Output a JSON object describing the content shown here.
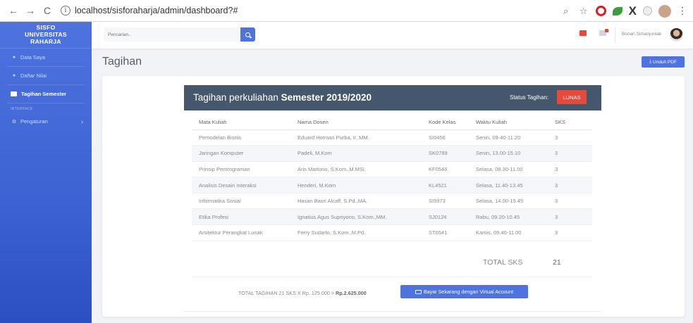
{
  "browser": {
    "url": "localhost/sisforaharja/admin/dashboard?#",
    "back_icon": "←",
    "forward_icon": "→",
    "reload_icon": "C",
    "info_icon": "i",
    "extension_x_label": "X"
  },
  "sidebar": {
    "brand": [
      "SISFO",
      "UNIVERSITAS",
      "RAHARJA"
    ],
    "items": [
      {
        "label": "Data Saya",
        "icon": "user-icon"
      },
      {
        "label": "Daftar Nilai",
        "icon": "list-icon"
      },
      {
        "label": "Tagihan Semester",
        "icon": "card-icon",
        "active": true
      }
    ],
    "section_heading": "INTERFACE",
    "settings": {
      "label": "Pengaturan",
      "icon": "gear-icon"
    }
  },
  "topbar": {
    "search_placeholder": "Pencarian..",
    "user_name": "Bonari Simanjuntak"
  },
  "page": {
    "title": "Tagihan",
    "pdf_button": "Unduh PDF"
  },
  "invoice": {
    "title_prefix": "Tagihan perkuliahan",
    "title_bold": "Semester 2019/2020",
    "status_label": "Status Tagihan:",
    "status_value": "LUNAS",
    "columns": [
      "Mata Kuliah",
      "Nama Dosen",
      "Kode Kelas",
      "Waktu Kuliah",
      "SKS"
    ],
    "rows": [
      [
        "Pemodelan Bisnis",
        "Eduard Hotman Purba, Ir, MM.",
        "SI0456",
        "Senin, 09-40-11.20",
        "3"
      ],
      [
        "Jaringan Komputer",
        "Padeli, M.Kom",
        "SK0789",
        "Senin, 13.00-15.10",
        "3"
      ],
      [
        "Prinsip Pemrograman",
        "Aris Martono, S.Kom.,M.MSi.",
        "KF0546",
        "Selasa, 08.30-11.00",
        "3"
      ],
      [
        "Analisis Desain Interaksi",
        "Henderi, M.Kom",
        "KL4521",
        "Selasa, 11.40-13.45",
        "3"
      ],
      [
        "Informatika Sosial",
        "Hasan Basri Alcaff, S.Pd.,MA.",
        "SI5973",
        "Selasa, 14.00-15.45",
        "3"
      ],
      [
        "Etika Profesi",
        "Ignatius Agus Supriyono, S.Kom.,MM.",
        "SJ0124",
        "Rabu, 09.20-10.45",
        "3"
      ],
      [
        "Arsitektur Perangkat Lunak",
        "Ferry Sudarto, S.Kom.,M.Pd.",
        "ST6541",
        "Kamis, 09.40-11.00",
        "3"
      ]
    ],
    "total_sks_label": "TOTAL SKS",
    "total_sks_value": "21",
    "payment_text": "TOTAL TAGIHAN 21 SKS X Rp. 125.000 = ",
    "payment_amount": "Rp.2.625.000",
    "pay_button": "Bayar Sekarang dengan Virtual Account"
  },
  "colors": {
    "primary": "#4e73df",
    "header_bg": "#45576d",
    "badge_red": "#e74a3b"
  }
}
